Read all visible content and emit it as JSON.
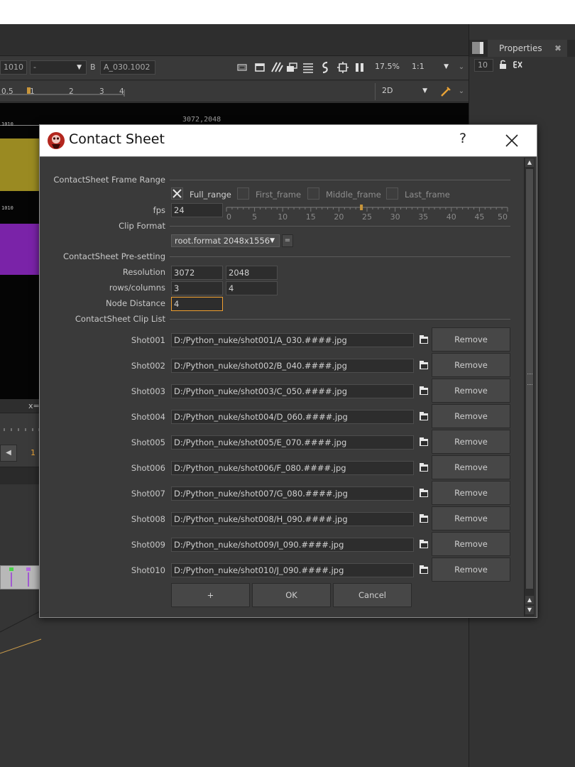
{
  "viewer": {
    "input_a_frame": "1010",
    "operation": "-",
    "b_label": "B",
    "input_b": "A_030.1002",
    "gain": "17.5%",
    "ratio": "1:1",
    "view_mode": "2D",
    "ruler_ticks": [
      "0.5",
      "1",
      "2",
      "3",
      "4"
    ],
    "resolution_label": "3072,2048",
    "thumb1_label": "1010",
    "thumb2_label": "1010",
    "status_text": "x=",
    "frame_number": "1"
  },
  "properties": {
    "tab_label": "Properties",
    "max_panels": "10"
  },
  "dialog": {
    "title": "Contact Sheet",
    "help": "?",
    "frame_range": {
      "section_label": "ContactSheet Frame Range",
      "options": [
        {
          "label": "Full_range",
          "checked": true
        },
        {
          "label": "First_frame",
          "checked": false
        },
        {
          "label": "Middle_frame",
          "checked": false
        },
        {
          "label": "Last_frame",
          "checked": false
        }
      ]
    },
    "fps": {
      "label": "fps",
      "value": "24",
      "slider_ticks": [
        "0",
        "5",
        "10",
        "15",
        "20",
        "25",
        "30",
        "35",
        "40",
        "45",
        "50"
      ],
      "slider_min": 0,
      "slider_max": 50,
      "slider_value": 24
    },
    "clip_format": {
      "section_label": "Clip Format",
      "value": "root.format 2048x1556",
      "eq_button": "="
    },
    "presetting": {
      "section_label": "ContactSheet Pre-setting",
      "resolution_label": "Resolution",
      "resolution_w": "3072",
      "resolution_h": "2048",
      "rows_label": "rows/columns",
      "rows": "3",
      "columns": "4",
      "node_distance_label": "Node Distance",
      "node_distance": "4"
    },
    "clip_list": {
      "section_label": "ContactSheet Clip List",
      "remove_label": "Remove",
      "shots": [
        {
          "name": "Shot001",
          "path": "D:/Python_nuke/shot001/A_030.####.jpg"
        },
        {
          "name": "Shot002",
          "path": "D:/Python_nuke/shot002/B_040.####.jpg"
        },
        {
          "name": "Shot003",
          "path": "D:/Python_nuke/shot003/C_050.####.jpg"
        },
        {
          "name": "Shot004",
          "path": "D:/Python_nuke/shot004/D_060.####.jpg"
        },
        {
          "name": "Shot005",
          "path": "D:/Python_nuke/shot005/E_070.####.jpg"
        },
        {
          "name": "Shot006",
          "path": "D:/Python_nuke/shot006/F_080.####.jpg"
        },
        {
          "name": "Shot007",
          "path": "D:/Python_nuke/shot007/G_080.####.jpg"
        },
        {
          "name": "Shot008",
          "path": "D:/Python_nuke/shot008/H_090.####.jpg"
        },
        {
          "name": "Shot009",
          "path": "D:/Python_nuke/shot009/I_090.####.jpg"
        },
        {
          "name": "Shot010",
          "path": "D:/Python_nuke/shot010/J_090.####.jpg"
        }
      ]
    },
    "buttons": {
      "add": "+",
      "ok": "OK",
      "cancel": "Cancel"
    },
    "colors": {
      "accent_orange": "#f0a030",
      "thumb_yellow": "#9a8a22",
      "thumb_purple": "#7a23a8"
    }
  }
}
